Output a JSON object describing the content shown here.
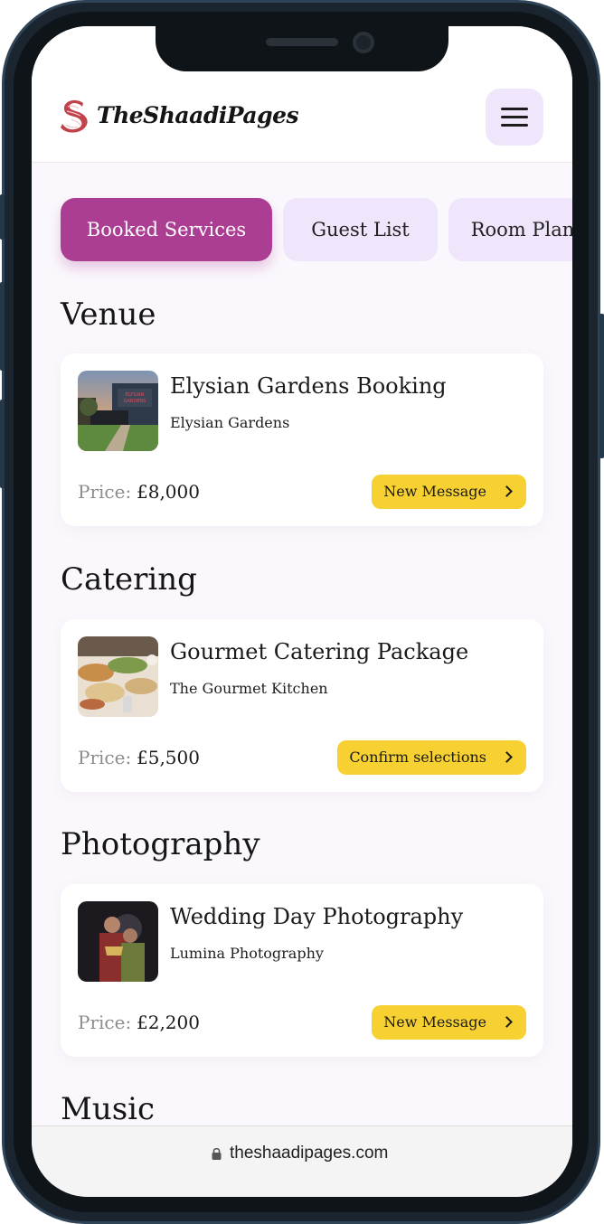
{
  "header": {
    "logo_text": "TheShaadiPages",
    "logo_icon": "s-monogram-logo",
    "menu_icon": "hamburger-menu-icon"
  },
  "tabs": [
    {
      "label": "Booked Services",
      "active": true
    },
    {
      "label": "Guest List",
      "active": false
    },
    {
      "label": "Room Plan",
      "active": false
    }
  ],
  "sections": [
    {
      "title": "Venue",
      "card": {
        "title": "Elysian Gardens Booking",
        "vendor": "Elysian Gardens",
        "price_label": "Price:",
        "price": "£8,000",
        "action": "New Message",
        "thumb_sign": "ELYSIAN GARDENS"
      }
    },
    {
      "title": "Catering",
      "card": {
        "title": "Gourmet Catering Package",
        "vendor": "The Gourmet Kitchen",
        "price_label": "Price:",
        "price": "£5,500",
        "action": "Confirm selections"
      }
    },
    {
      "title": "Photography",
      "card": {
        "title": "Wedding Day Photography",
        "vendor": "Lumina Photography",
        "price_label": "Price:",
        "price": "£2,200",
        "action": "New Message"
      }
    },
    {
      "title": "Music"
    }
  ],
  "browser": {
    "url": "theshaadipages.com",
    "lock_icon": "lock-icon"
  },
  "colors": {
    "accent": "#ab3d93",
    "tab_bg": "#efe6fb",
    "action_bg": "#f7d131",
    "page_bg": "#fbf8fd"
  }
}
